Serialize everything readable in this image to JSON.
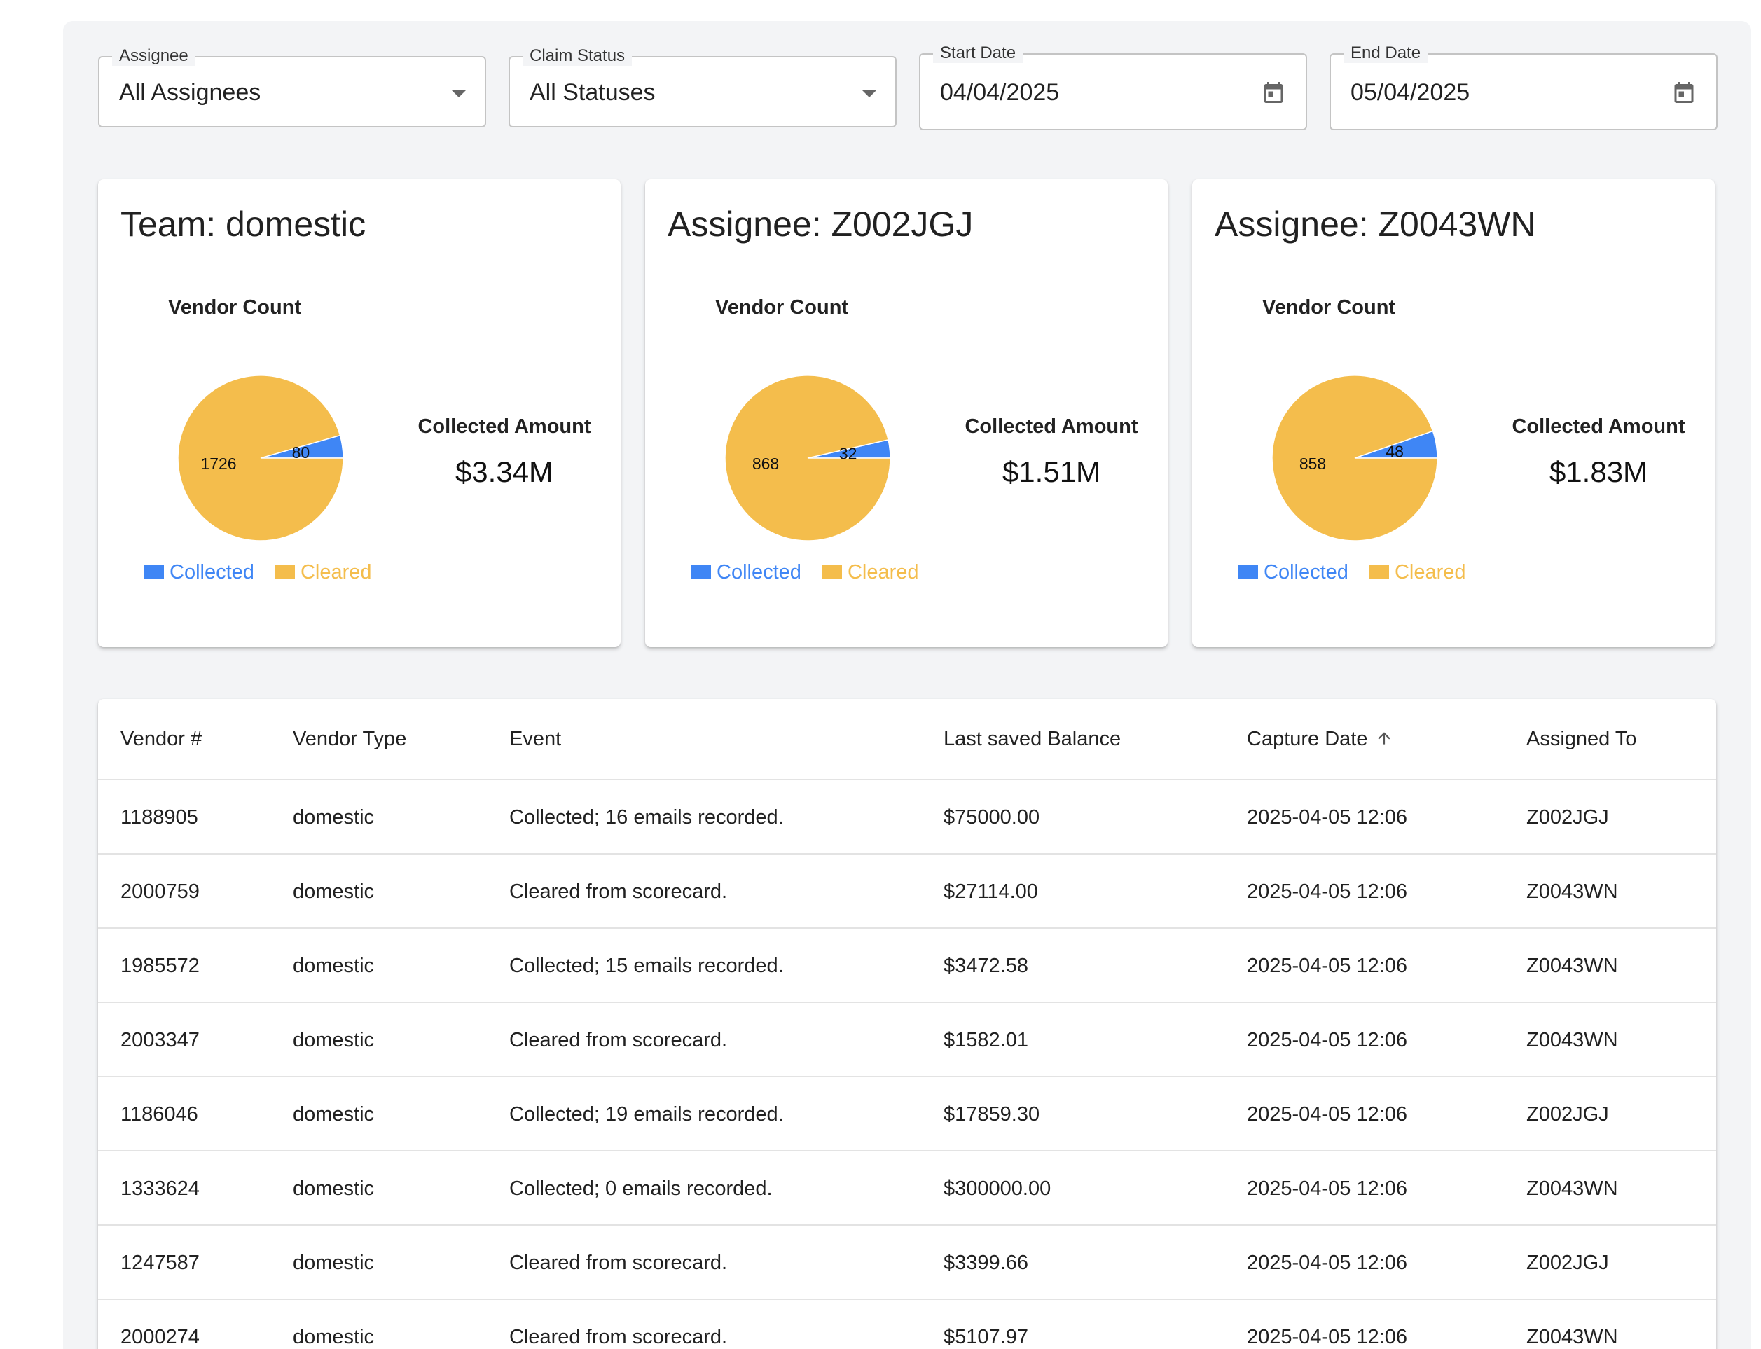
{
  "colors": {
    "collected": "#3f86f5",
    "cleared": "#f4bd4c"
  },
  "filters": {
    "assignee": {
      "label": "Assignee",
      "value": "All Assignees"
    },
    "status": {
      "label": "Claim Status",
      "value": "All Statuses"
    },
    "start": {
      "label": "Start Date",
      "value": "04/04/2025"
    },
    "end": {
      "label": "End Date",
      "value": "05/04/2025"
    }
  },
  "cards": [
    {
      "title": "Team: domestic",
      "pie_title": "Vendor Count",
      "amount_label": "Collected Amount",
      "amount_value": "$3.34M",
      "legend": [
        "Collected",
        "Cleared"
      ]
    },
    {
      "title": "Assignee: Z002JGJ",
      "pie_title": "Vendor Count",
      "amount_label": "Collected Amount",
      "amount_value": "$1.51M",
      "legend": [
        "Collected",
        "Cleared"
      ]
    },
    {
      "title": "Assignee: Z0043WN",
      "pie_title": "Vendor Count",
      "amount_label": "Collected Amount",
      "amount_value": "$1.83M",
      "legend": [
        "Collected",
        "Cleared"
      ]
    }
  ],
  "chart_data": [
    {
      "type": "pie",
      "title": "Vendor Count",
      "categories": [
        "Collected",
        "Cleared"
      ],
      "values": [
        80,
        1726
      ]
    },
    {
      "type": "pie",
      "title": "Vendor Count",
      "categories": [
        "Collected",
        "Cleared"
      ],
      "values": [
        32,
        868
      ]
    },
    {
      "type": "pie",
      "title": "Vendor Count",
      "categories": [
        "Collected",
        "Cleared"
      ],
      "values": [
        48,
        858
      ]
    }
  ],
  "table": {
    "columns": [
      "Vendor #",
      "Vendor Type",
      "Event",
      "Last saved Balance",
      "Capture Date",
      "Assigned To"
    ],
    "sort_icon": "arrow-up-icon",
    "rows": [
      [
        "1188905",
        "domestic",
        "Collected; 16 emails recorded.",
        "$75000.00",
        "2025-04-05 12:06",
        "Z002JGJ"
      ],
      [
        "2000759",
        "domestic",
        "Cleared from scorecard.",
        "$27114.00",
        "2025-04-05 12:06",
        "Z0043WN"
      ],
      [
        "1985572",
        "domestic",
        "Collected; 15 emails recorded.",
        "$3472.58",
        "2025-04-05 12:06",
        "Z0043WN"
      ],
      [
        "2003347",
        "domestic",
        "Cleared from scorecard.",
        "$1582.01",
        "2025-04-05 12:06",
        "Z0043WN"
      ],
      [
        "1186046",
        "domestic",
        "Collected; 19 emails recorded.",
        "$17859.30",
        "2025-04-05 12:06",
        "Z002JGJ"
      ],
      [
        "1333624",
        "domestic",
        "Collected; 0 emails recorded.",
        "$300000.00",
        "2025-04-05 12:06",
        "Z0043WN"
      ],
      [
        "1247587",
        "domestic",
        "Cleared from scorecard.",
        "$3399.66",
        "2025-04-05 12:06",
        "Z002JGJ"
      ],
      [
        "2000274",
        "domestic",
        "Cleared from scorecard.",
        "$5107.97",
        "2025-04-05 12:06",
        "Z0043WN"
      ]
    ]
  }
}
